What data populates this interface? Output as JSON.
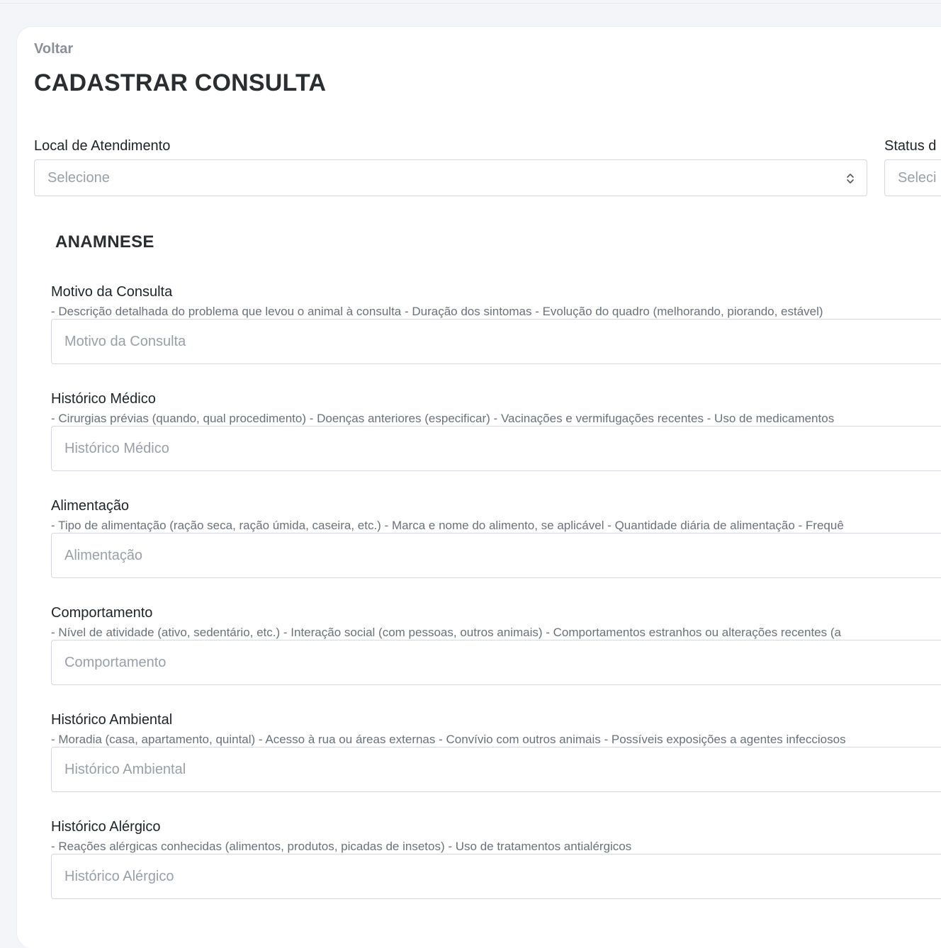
{
  "header": {
    "back_label": "Voltar",
    "title": "CADASTRAR CONSULTA"
  },
  "top_fields": [
    {
      "label": "Local de Atendimento",
      "placeholder": "Selecione"
    },
    {
      "label": "Status d",
      "placeholder": "Seleci"
    }
  ],
  "section": {
    "title": "ANAMNESE"
  },
  "fields": [
    {
      "label": "Motivo da Consulta",
      "hint": "- Descrição detalhada do problema que levou o animal à consulta - Duração dos sintomas - Evolução do quadro (melhorando, piorando, estável)",
      "placeholder": "Motivo da Consulta"
    },
    {
      "label": "Histórico Médico",
      "hint": "- Cirurgias prévias (quando, qual procedimento) - Doenças anteriores (especificar) - Vacinações e vermifugações recentes - Uso de medicamentos",
      "placeholder": "Histórico Médico"
    },
    {
      "label": "Alimentação",
      "hint": "- Tipo de alimentação (ração seca, ração úmida, caseira, etc.) - Marca e nome do alimento, se aplicável - Quantidade diária de alimentação - Frequê",
      "placeholder": "Alimentação"
    },
    {
      "label": "Comportamento",
      "hint": "- Nível de atividade (ativo, sedentário, etc.) - Interação social (com pessoas, outros animais) - Comportamentos estranhos ou alterações recentes (a",
      "placeholder": "Comportamento"
    },
    {
      "label": "Histórico Ambiental",
      "hint": "- Moradia (casa, apartamento, quintal) - Acesso à rua ou áreas externas - Convívio com outros animais - Possíveis exposições a agentes infecciosos",
      "placeholder": "Histórico Ambiental"
    },
    {
      "label": "Histórico Alérgico",
      "hint": "- Reações alérgicas conhecidas (alimentos, produtos, picadas de insetos) - Uso de tratamentos antialérgicos",
      "placeholder": "Histórico Alérgico"
    }
  ]
}
